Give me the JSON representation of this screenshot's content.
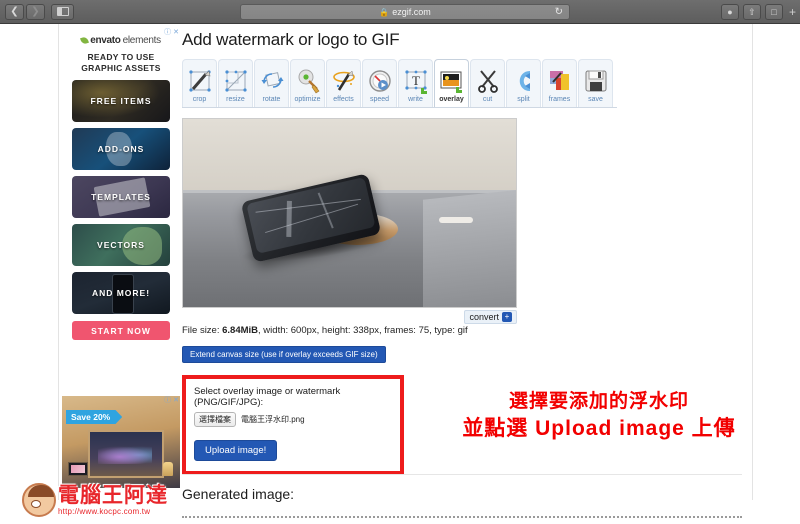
{
  "browser": {
    "back_icon": "chevron-left-icon",
    "forward_icon": "chevron-right-icon",
    "sidebar_icon": "sidebar-toggle-icon",
    "url": "ezgif.com",
    "lock_icon": "lock-icon",
    "reload_icon": "reload-icon",
    "download_icon": "download-icon",
    "share_icon": "share-icon",
    "tabs_icon": "tabs-icon",
    "new_tab_icon": "plus-icon"
  },
  "ads": {
    "envato": {
      "brand_1": "envato",
      "brand_2": "elements",
      "headline_line1": "READY TO USE",
      "headline_line2": "GRAPHIC ASSETS",
      "info_icon": "info-icon",
      "close_icon": "close-icon",
      "cards": [
        {
          "label": "FREE ITEMS"
        },
        {
          "label": "ADD-ONS"
        },
        {
          "label": "TEMPLATES"
        },
        {
          "label": "VECTORS"
        },
        {
          "label": "AND MORE!"
        }
      ],
      "cta": "START NOW"
    },
    "hotel": {
      "ribbon": "Save 20%",
      "info_icon": "info-icon",
      "close_icon": "close-icon"
    }
  },
  "watermark": {
    "title": "電腦王阿達",
    "url": "http://www.kocpc.com.tw",
    "avatar_icon": "avatar-icon"
  },
  "main": {
    "page_title": "Add watermark or logo to GIF",
    "toolbar": [
      {
        "label": "crop",
        "icon": "crop-icon",
        "active": false
      },
      {
        "label": "resize",
        "icon": "resize-icon",
        "active": false
      },
      {
        "label": "rotate",
        "icon": "rotate-icon",
        "active": false
      },
      {
        "label": "optimize",
        "icon": "optimize-icon",
        "active": false
      },
      {
        "label": "effects",
        "icon": "effects-icon",
        "active": false
      },
      {
        "label": "speed",
        "icon": "speed-icon",
        "active": false
      },
      {
        "label": "write",
        "icon": "write-icon",
        "active": false
      },
      {
        "label": "overlay",
        "icon": "overlay-icon",
        "active": true
      },
      {
        "label": "cut",
        "icon": "cut-icon",
        "active": false
      },
      {
        "label": "split",
        "icon": "split-icon",
        "active": false
      },
      {
        "label": "frames",
        "icon": "frames-icon",
        "active": false
      },
      {
        "label": "save",
        "icon": "save-icon",
        "active": false
      }
    ],
    "preview_alt": "Animated GIF preview of a smartphone resting on a wireless charger",
    "convert_label": "convert",
    "convert_icon": "plus-box-icon",
    "file_info_prefix": "File size: ",
    "file_size": "6.84MiB",
    "file_info_rest": ", width: 600px, height: 338px, frames: 75, type: gif",
    "extend_button": "Extend canvas size (use if overlay exceeds GIF size)",
    "overlay_panel": {
      "label": "Select overlay image or watermark (PNG/GIF/JPG):",
      "choose_file_button": "選擇檔案",
      "file_name": "電腦王浮水印.png",
      "upload_button": "Upload image!"
    },
    "generated_label": "Generated image:"
  },
  "annotation": {
    "line1": "選擇要添加的浮水印",
    "line2": "並點選 Upload image 上傳",
    "color": "#f20000"
  }
}
